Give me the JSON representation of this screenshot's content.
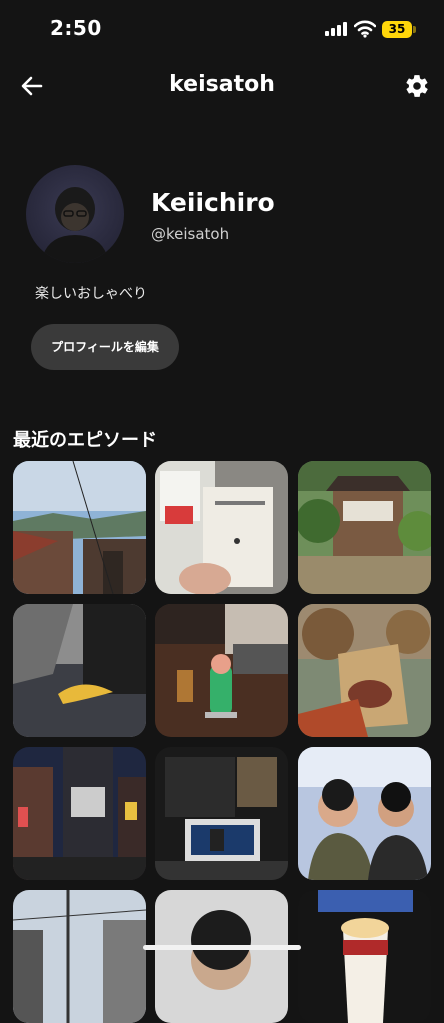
{
  "status_bar": {
    "time": "2:50",
    "battery": "35"
  },
  "header": {
    "title": "keisatoh",
    "back_icon": "arrow-left-icon",
    "settings_icon": "gear-icon"
  },
  "profile": {
    "display_name": "Keiichiro",
    "handle": "@keisatoh",
    "bio": "楽しいおしゃべり",
    "edit_button": "プロフィールを編集"
  },
  "episodes": {
    "section_title": "最近のエピソード",
    "items": [
      {
        "desc": "town-street-photo"
      },
      {
        "desc": "book-photo"
      },
      {
        "desc": "japanese-house-photo"
      },
      {
        "desc": "bag-banana-photo"
      },
      {
        "desc": "cafe-table-photo"
      },
      {
        "desc": "sweet-potato-photo"
      },
      {
        "desc": "city-night-photo"
      },
      {
        "desc": "exhibit-booth-photo"
      },
      {
        "desc": "friends-selfie-photo"
      },
      {
        "desc": "street-wires-photo"
      },
      {
        "desc": "person-portrait-photo"
      },
      {
        "desc": "cinema-popcorn-photo"
      }
    ]
  }
}
